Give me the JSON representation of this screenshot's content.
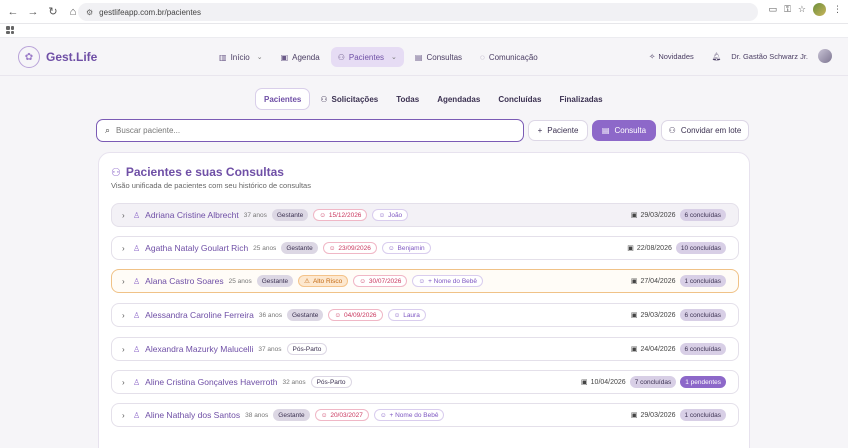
{
  "browser": {
    "url": "gestlifeapp.com.br/pacientes"
  },
  "app": {
    "name": "Gest.Life"
  },
  "nav": {
    "items": [
      {
        "label": "Início",
        "icon": "bar-chart-icon",
        "dropdown": true,
        "active": false
      },
      {
        "label": "Agenda",
        "icon": "calendar-icon",
        "dropdown": false,
        "active": false
      },
      {
        "label": "Pacientes",
        "icon": "users-icon",
        "dropdown": true,
        "active": true
      },
      {
        "label": "Consultas",
        "icon": "document-icon",
        "dropdown": false,
        "active": false
      },
      {
        "label": "Comunicação",
        "icon": "chat-icon",
        "dropdown": false,
        "active": false
      }
    ],
    "news_label": "Novidades",
    "user_name": "Dr. Gastão Schwarz Jr."
  },
  "tabs": [
    "Pacientes",
    "Solicitações",
    "Todas",
    "Agendadas",
    "Concluídas",
    "Finalizadas"
  ],
  "search": {
    "placeholder": "Buscar paciente..."
  },
  "actions": {
    "add_patient": "Paciente",
    "consult": "Consulta",
    "invite": "Convidar em lote"
  },
  "list": {
    "title": "Pacientes e suas Consultas",
    "subtitle": "Visão unificada de pacientes com seu histórico de consultas",
    "rows": [
      {
        "name": "Adriana Cristine Albrecht",
        "age": "37 anos",
        "status": "Gestante",
        "risk": "",
        "due": "15/12/2026",
        "baby": "João",
        "date": "29/03/2026",
        "counts": [
          {
            "text": "6 concluídas",
            "style": "lav"
          }
        ]
      },
      {
        "name": "Agatha Nataly Goulart Rich",
        "age": "25 anos",
        "status": "Gestante",
        "risk": "",
        "due": "23/09/2026",
        "baby": "Benjamin",
        "date": "22/08/2026",
        "counts": [
          {
            "text": "10 concluídas",
            "style": "lav"
          }
        ]
      },
      {
        "name": "Alana Castro Soares",
        "age": "25 anos",
        "status": "Gestante",
        "risk": "Alto Risco",
        "due": "30/07/2026",
        "baby": "+ Nome do Bebê",
        "date": "27/04/2026",
        "counts": [
          {
            "text": "1 concluídas",
            "style": "lav"
          }
        ]
      },
      {
        "name": "Alessandra Caroline Ferreira",
        "age": "36 anos",
        "status": "Gestante",
        "risk": "",
        "due": "04/09/2026",
        "baby": "Laura",
        "date": "29/03/2026",
        "counts": [
          {
            "text": "6 concluídas",
            "style": "lav"
          }
        ]
      },
      {
        "name": "Alexandra Mazurky Malucelli",
        "age": "37 anos",
        "status": "Pós-Parto",
        "risk": "",
        "due": "",
        "baby": "",
        "date": "24/04/2026",
        "counts": [
          {
            "text": "6 concluídas",
            "style": "lav"
          }
        ]
      },
      {
        "name": "Aline Cristina Gonçalves Haverroth",
        "age": "32 anos",
        "status": "Pós-Parto",
        "risk": "",
        "due": "",
        "baby": "",
        "date": "10/04/2026",
        "counts": [
          {
            "text": "7 concluídas",
            "style": "lav"
          },
          {
            "text": "1 pendentes",
            "style": "purple"
          }
        ]
      },
      {
        "name": "Aline Nathaly dos Santos",
        "age": "38 anos",
        "status": "Gestante",
        "risk": "",
        "due": "20/03/2027",
        "baby": "+ Nome do Bebê",
        "date": "29/03/2026",
        "counts": [
          {
            "text": "1 concluídas",
            "style": "lav"
          }
        ]
      }
    ]
  },
  "colors": {
    "accent": "#8d68c9",
    "brand_text": "#6f4fa6",
    "risk": "#c46b14",
    "due": "#c9375e"
  }
}
